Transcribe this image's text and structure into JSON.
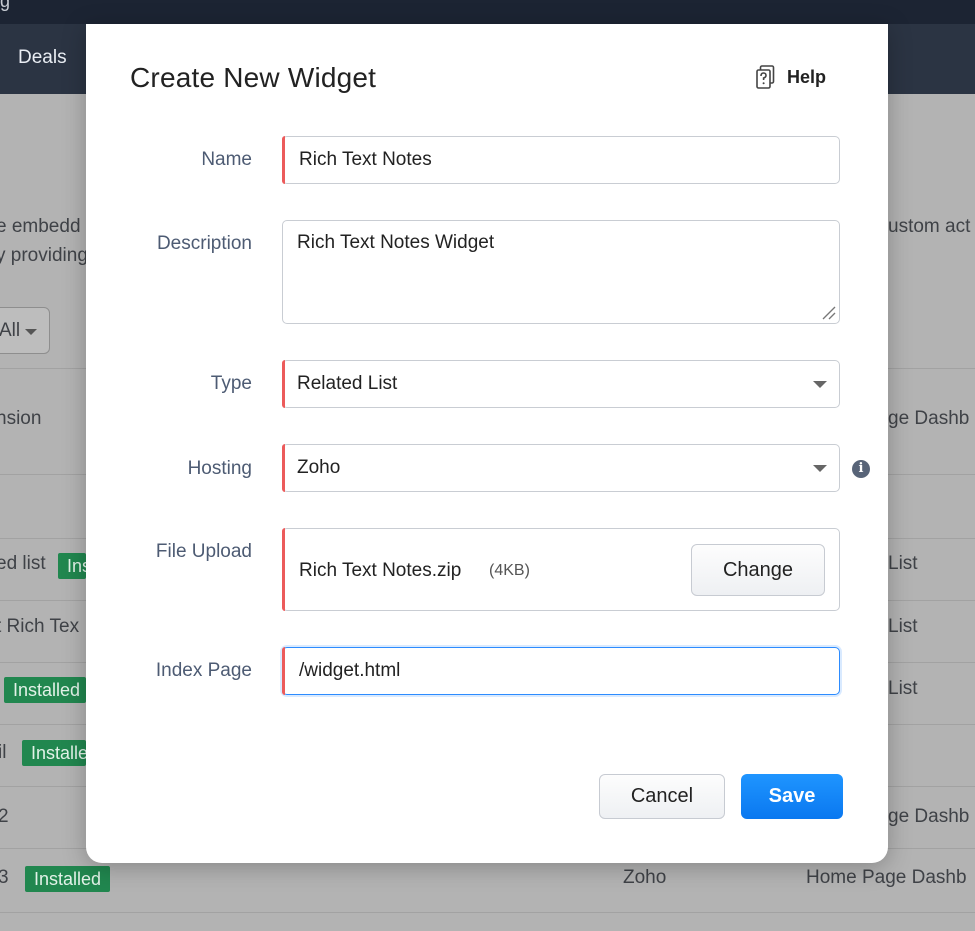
{
  "background": {
    "top_fragment": "g",
    "nav_item": "Deals",
    "intro_left_1": "e embedd",
    "intro_left_2": "y providing",
    "intro_right": "ustom act",
    "filter_value": "All",
    "rows": [
      {
        "left": "nsion",
        "right": "ge Dashb"
      },
      {
        "left": "ed list",
        "badge": "Installed",
        "right": "List"
      },
      {
        "left": "t Rich Tex",
        "right": "List"
      },
      {
        "left": "",
        "badge": "Installed",
        "right": "List"
      },
      {
        "left": "il",
        "badge": "Installed",
        "right": ""
      },
      {
        "left": "2",
        "right": "ge Dashb"
      },
      {
        "left": "3",
        "badge": "Installed",
        "middle": "Zoho",
        "right": "Home Page Dashb"
      }
    ]
  },
  "modal": {
    "title": "Create New Widget",
    "help_label": "Help",
    "help_icon": "help-document-icon",
    "fields": {
      "name": {
        "label": "Name",
        "value": "Rich Text Notes"
      },
      "description": {
        "label": "Description",
        "value": "Rich Text Notes Widget"
      },
      "type": {
        "label": "Type",
        "value": "Related List"
      },
      "hosting": {
        "label": "Hosting",
        "value": "Zoho",
        "info_icon": "i"
      },
      "file_upload": {
        "label": "File Upload",
        "file_name": "Rich Text Notes.zip",
        "file_size": "(4KB)",
        "change_label": "Change"
      },
      "index_page": {
        "label": "Index Page",
        "value": "/widget.html"
      }
    },
    "buttons": {
      "cancel": "Cancel",
      "save": "Save"
    }
  },
  "colors": {
    "primary": "#0a78f0",
    "required_marker": "#ec5b5b",
    "installed_badge": "#21874f",
    "nav_bg": "#2b3443"
  }
}
